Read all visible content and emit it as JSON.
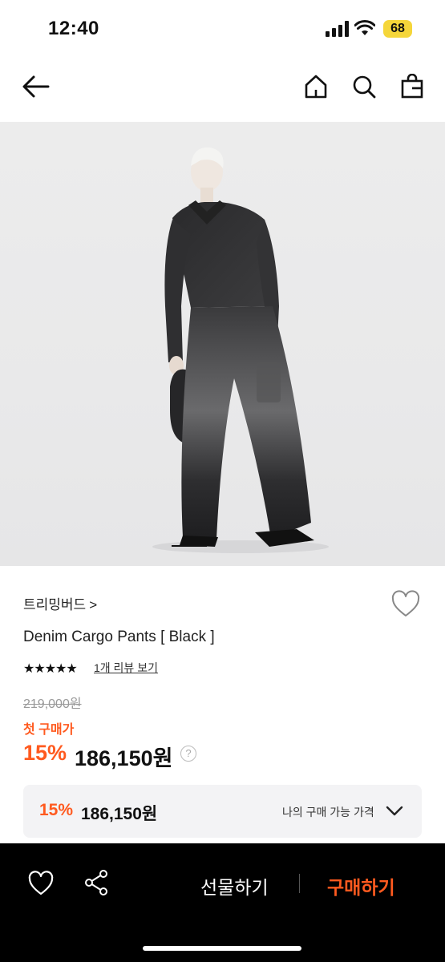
{
  "status_bar": {
    "time": "12:40",
    "battery": "68"
  },
  "header": {
    "icons": [
      "back-arrow-icon",
      "home-icon",
      "search-icon",
      "shopping-bag-icon"
    ]
  },
  "product": {
    "brand": "트리밍버드",
    "brand_chevron": ">",
    "title": "Denim Cargo Pants [ Black ]",
    "rating_stars": "★★★★★",
    "rating": 5,
    "reviews_link": "1개 리뷰 보기",
    "original_price": "219,000원",
    "first_purchase_label": "첫 구매가",
    "discount": "15%",
    "price": "186,150원",
    "help_icon": "?"
  },
  "my_price": {
    "discount": "15%",
    "price": "186,150원",
    "label": "나의 구매 가능 가격"
  },
  "bottom_bar": {
    "gift_label": "선물하기",
    "buy_label": "구매하기"
  },
  "colors": {
    "accent": "#ff5a1f",
    "bottom_bg": "#000000"
  }
}
